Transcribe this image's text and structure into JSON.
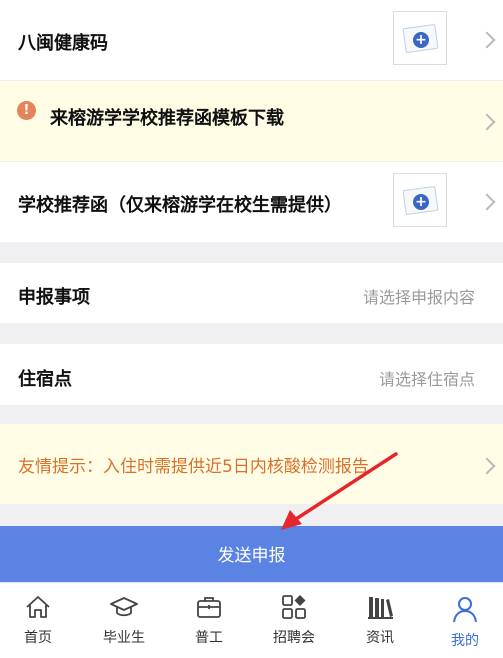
{
  "form": {
    "health_code": {
      "label": "八闽健康码"
    },
    "template_notice": {
      "label": "来榕游学学校推荐函模板下载"
    },
    "recommendation": {
      "label": "学校推荐函（仅来榕游学在校生需提供）"
    },
    "declaration_item": {
      "label": "申报事项",
      "placeholder": "请选择申报内容"
    },
    "accommodation": {
      "label": "住宿点",
      "placeholder": "请选择住宿点"
    },
    "tip": {
      "text": "友情提示：入住时需提供近5日内核酸检测报告"
    },
    "submit_label": "发送申报"
  },
  "tabbar": {
    "items": [
      {
        "label": "首页",
        "icon": "home-icon"
      },
      {
        "label": "毕业生",
        "icon": "graduation-cap-icon"
      },
      {
        "label": "普工",
        "icon": "briefcase-icon"
      },
      {
        "label": "招聘会",
        "icon": "grid-apps-icon"
      },
      {
        "label": "资讯",
        "icon": "books-icon"
      },
      {
        "label": "我的",
        "icon": "user-icon",
        "active": true
      }
    ]
  },
  "colors": {
    "accent": "#5b83e3",
    "active_tab": "#3b6fd8",
    "tip_text": "#d9712a",
    "notice_bg": "#fffde6",
    "annotation_arrow": "#e5262c"
  }
}
